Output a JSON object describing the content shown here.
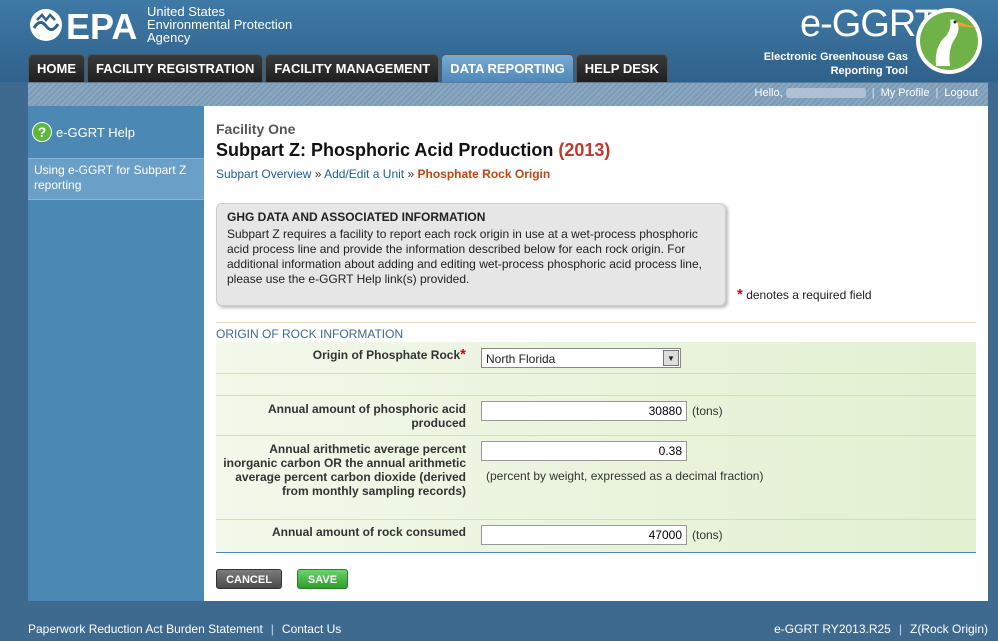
{
  "header": {
    "agency_line1": "United States",
    "agency_line2": "Environmental Protection",
    "agency_line3": "Agency",
    "app_title": "e-GGRT",
    "app_subtitle_1": "Electronic Greenhouse Gas",
    "app_subtitle_2": "Reporting Tool",
    "epa_logo_text": "EPA"
  },
  "nav": {
    "tabs": [
      {
        "label": "HOME"
      },
      {
        "label": "FACILITY REGISTRATION"
      },
      {
        "label": "FACILITY MANAGEMENT"
      },
      {
        "label": "DATA REPORTING",
        "active": true
      },
      {
        "label": "HELP DESK"
      }
    ]
  },
  "user": {
    "greeting": "Hello,",
    "my_profile": "My Profile",
    "logout": "Logout",
    "separator": "|"
  },
  "sidebar": {
    "help_label": "e-GGRT Help",
    "help_link": "Using e-GGRT for Subpart Z reporting"
  },
  "main": {
    "facility": "Facility One",
    "title": "Subpart Z: Phosphoric Acid Production",
    "year": "(2013)",
    "breadcrumb": {
      "overview": "Subpart Overview",
      "sep": "»",
      "add_edit": "Add/Edit a Unit",
      "current": "Phosphate Rock Origin"
    },
    "info": {
      "heading": "GHG DATA AND ASSOCIATED INFORMATION",
      "body": "Subpart Z requires a facility to report each rock origin in use at a wet-process phosphoric acid process line and provide the information described below for each rock origin. For additional information about adding and editing wet-process phosphoric acid process line, please use the e-GGRT Help link(s) provided."
    },
    "required_note": "denotes a required field",
    "star": "*",
    "section_title": "ORIGIN OF ROCK INFORMATION",
    "form": {
      "origin_label": "Origin of Phosphate Rock",
      "origin_value": "North Florida",
      "phos_acid_label": "Annual amount of phosphoric acid produced",
      "phos_acid_value": "30880",
      "phos_acid_unit": "(tons)",
      "carbon_label": "Annual arithmetic average percent inorganic carbon OR the annual arithmetic average percent carbon dioxide (derived from monthly sampling records)",
      "carbon_value": "0.38",
      "carbon_unit": "(percent by weight, expressed as a decimal fraction)",
      "rock_label": "Annual amount of rock consumed",
      "rock_value": "47000",
      "rock_unit": "(tons)"
    },
    "buttons": {
      "cancel": "CANCEL",
      "save": "SAVE"
    }
  },
  "footer": {
    "paperwork": "Paperwork Reduction Act Burden Statement",
    "contact": "Contact Us",
    "version": "e-GGRT RY2013.R25",
    "page_code": "Z(Rock Origin)",
    "separator": "|"
  },
  "colors": {
    "header_blue": "#3f79a6",
    "active_tab": "#4f88ba",
    "required_red": "#d0021b",
    "save_green": "#2e9d2e",
    "breadcrumb_current": "#c24614"
  }
}
